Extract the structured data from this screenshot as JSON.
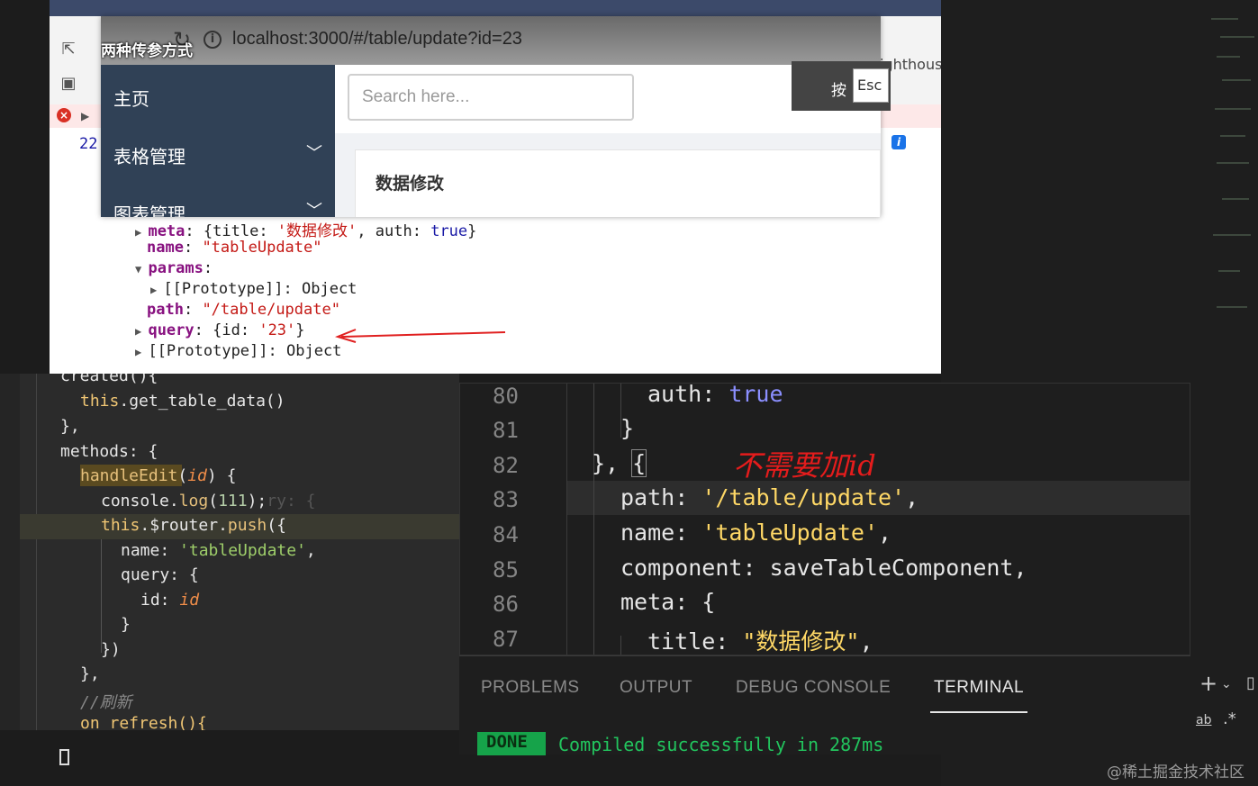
{
  "browser": {
    "url": "localhost:3000/#/table/update?id=23",
    "overlay_title": "两种传参方式",
    "lighthouse_tab": "ighthous",
    "console_line": "22",
    "esc_hint_text": "按",
    "esc_key_label": "Esc"
  },
  "app": {
    "sidebar": {
      "items": [
        {
          "label": "主页"
        },
        {
          "label": "表格管理"
        },
        {
          "label": "图表管理"
        }
      ]
    },
    "search_placeholder": "Search here...",
    "card_title": "数据修改"
  },
  "console_object": {
    "meta_key": "meta",
    "meta_title_key": "title",
    "meta_title_value": "'数据修改'",
    "meta_auth_key": "auth",
    "meta_auth_value": "true",
    "name_key": "name",
    "name_value": "\"tableUpdate\"",
    "params_key": "params",
    "prototype_label": "[[Prototype]]",
    "prototype_value": "Object",
    "path_key": "path",
    "path_value": "\"/table/update\"",
    "query_key": "query",
    "query_id_key": "id",
    "query_id_value": "'23'"
  },
  "left_code": {
    "l_created": "created(){",
    "l_this": "this",
    "l_get": "get_table_data",
    "l_close": "},",
    "l_methods": "methods: {",
    "l_handle": "handleEdit",
    "l_id_param": "id",
    "l_console": "console",
    "l_log": "log",
    "l_111": "111",
    "l_router": "$router",
    "l_push": "push",
    "l_name_key": "name:",
    "l_name_val": "'tableUpdate'",
    "l_query_key": "query:",
    "l_id_key": "id:",
    "l_id_val": "id",
    "l_comment": "//刷新",
    "l_refresh": "on_refresh(){",
    "l_ghost": "ry: {"
  },
  "right_code": {
    "line_numbers": [
      "80",
      "81",
      "82",
      "83",
      "84",
      "85",
      "86",
      "87"
    ],
    "auth_key": "auth:",
    "auth_val": "true",
    "path_key": "path:",
    "path_val": "'/table/update'",
    "name_key": "name:",
    "name_val": "'tableUpdate'",
    "component_line": "component: saveTableComponent,",
    "meta_line": "meta: {",
    "title_key": "title:",
    "title_val": "\"数据修改\""
  },
  "annotation": "不需要加id",
  "panel": {
    "tabs": [
      "PROBLEMS",
      "OUTPUT",
      "DEBUG CONSOLE",
      "TERMINAL"
    ],
    "active_tab": "TERMINAL",
    "done_label": "DONE",
    "compiled_text": "Compiled successfully in 287ms"
  },
  "watermark": "@稀土掘金技术社区",
  "colors": {
    "sidebar_bg": "#304156",
    "annotation_red": "#e51c1c",
    "done_green": "#16a34a"
  }
}
